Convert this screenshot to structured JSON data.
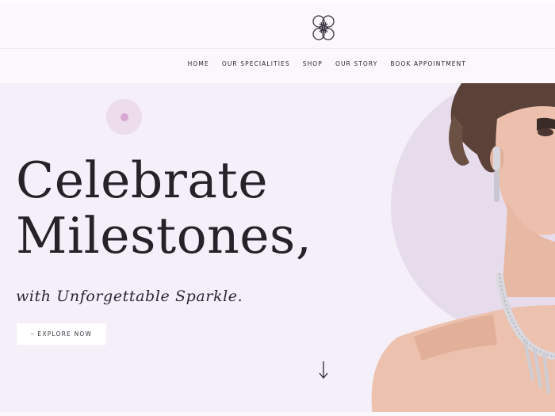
{
  "nav": {
    "items": [
      {
        "label": "HOME"
      },
      {
        "label": "OUR SPECIALITIES"
      },
      {
        "label": "SHOP"
      },
      {
        "label": "OUR STORY"
      },
      {
        "label": "BOOK APPOINTMENT"
      }
    ]
  },
  "hero": {
    "title_line1": "Celebrate",
    "title_line2": "Milestones,",
    "subtitle": "with Unforgettable Sparkle.",
    "cta_label": "– EXPLORE NOW"
  },
  "icons": {
    "logo": "clover-logo-icon",
    "scroll": "arrow-down-icon"
  },
  "colors": {
    "background": "#f4eff8",
    "accent_circle": "#e6dcec",
    "dot": "#d7a6d3",
    "text": "#26222a"
  }
}
